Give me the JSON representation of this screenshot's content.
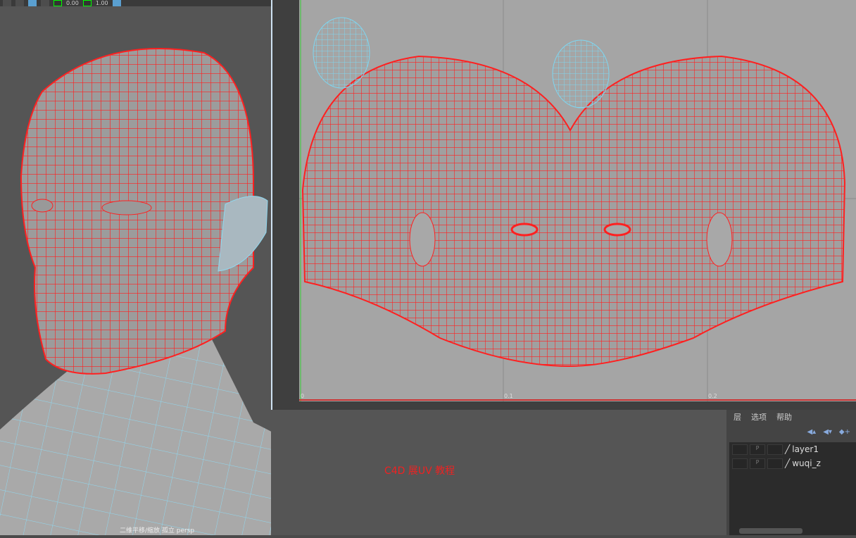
{
  "toolbar": {
    "value1": "0.00",
    "value2": "1.00"
  },
  "uv_editor": {
    "axis_labels": [
      "0",
      "0.1",
      "0.2"
    ]
  },
  "layers": {
    "menu": [
      "层",
      "选项",
      "帮助"
    ],
    "items": [
      {
        "name": "layer1",
        "playback": "P"
      },
      {
        "name": "wuqi_z",
        "playback": "P"
      }
    ]
  },
  "caption": "C4D 展UV 教程",
  "viewport": {
    "label": "二维平移/缩放  孤立  persp"
  },
  "colors": {
    "selected_wire": "#ff2020",
    "unselected_wire": "#7fd6f0"
  }
}
